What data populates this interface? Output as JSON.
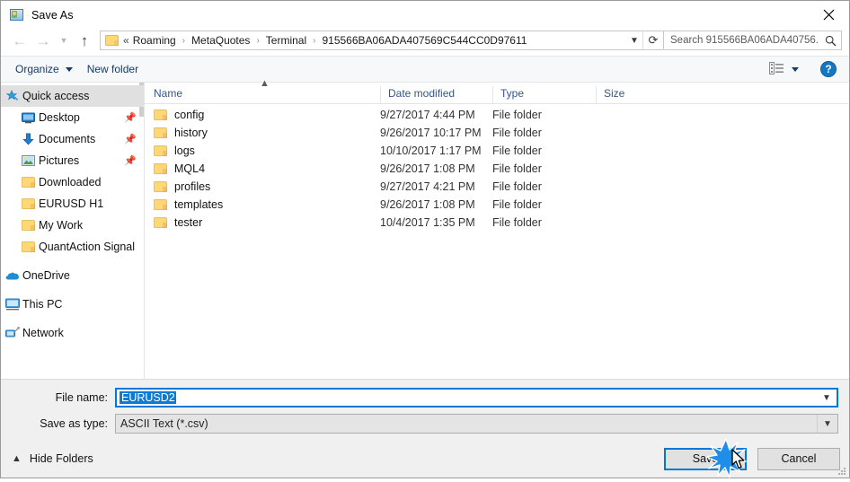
{
  "window": {
    "title": "Save As",
    "title_icon": "mt4-image-icon",
    "close_label": "close-icon"
  },
  "nav": {
    "back_icon": "arrow-left-icon",
    "forward_icon": "arrow-right-icon",
    "recent_icon": "chevron-down-icon",
    "up_icon": "arrow-up-icon",
    "breadcrumb": {
      "folder_icon": "folder-icon",
      "prefix": "«",
      "items": [
        "Roaming",
        "MetaQuotes",
        "Terminal",
        "915566BA06ADA407569C544CC0D97611"
      ],
      "separator": "›",
      "dropdown_icon": "chevron-down-icon",
      "refresh_icon": "refresh-icon"
    },
    "search": {
      "placeholder": "Search 915566BA06ADA40756...",
      "icon": "search-icon"
    }
  },
  "toolbar": {
    "organize_label": "Organize",
    "organize_caret": "caret-down-icon",
    "new_folder_label": "New folder",
    "view_icon": "details-view-icon",
    "view_caret": "caret-down-icon",
    "help_label": "?",
    "help_icon": "help-icon"
  },
  "sidebar": {
    "items": [
      {
        "label": "Quick access",
        "icon": "star-pin-icon",
        "level": "root",
        "selected": true,
        "pinned": false
      },
      {
        "label": "Desktop",
        "icon": "desktop-icon",
        "level": "child",
        "selected": false,
        "pinned": true
      },
      {
        "label": "Documents",
        "icon": "documents-arrow-icon",
        "level": "child",
        "selected": false,
        "pinned": true
      },
      {
        "label": "Pictures",
        "icon": "pictures-icon",
        "level": "child",
        "selected": false,
        "pinned": true
      },
      {
        "label": "Downloaded",
        "icon": "folder-icon",
        "level": "child",
        "selected": false,
        "pinned": false
      },
      {
        "label": "EURUSD H1",
        "icon": "folder-icon",
        "level": "child",
        "selected": false,
        "pinned": false
      },
      {
        "label": "My Work",
        "icon": "folder-icon",
        "level": "child",
        "selected": false,
        "pinned": false
      },
      {
        "label": "QuantAction Signal",
        "icon": "folder-icon",
        "level": "child",
        "selected": false,
        "pinned": false
      },
      {
        "label": "OneDrive",
        "icon": "onedrive-cloud-icon",
        "level": "root",
        "selected": false,
        "pinned": false,
        "gap_before": true
      },
      {
        "label": "This PC",
        "icon": "this-pc-icon",
        "level": "root",
        "selected": false,
        "pinned": false,
        "gap_before": true
      },
      {
        "label": "Network",
        "icon": "network-icon",
        "level": "root",
        "selected": false,
        "pinned": false,
        "gap_before": true
      }
    ]
  },
  "filelist": {
    "columns": [
      "Name",
      "Date modified",
      "Type",
      "Size"
    ],
    "sort_indicator": "sort-ascending-caret",
    "rows": [
      {
        "name": "config",
        "date": "9/27/2017 4:44 PM",
        "type": "File folder",
        "size": ""
      },
      {
        "name": "history",
        "date": "9/26/2017 10:17 PM",
        "type": "File folder",
        "size": ""
      },
      {
        "name": "logs",
        "date": "10/10/2017 1:17 PM",
        "type": "File folder",
        "size": ""
      },
      {
        "name": "MQL4",
        "date": "9/26/2017 1:08 PM",
        "type": "File folder",
        "size": ""
      },
      {
        "name": "profiles",
        "date": "9/27/2017 4:21 PM",
        "type": "File folder",
        "size": ""
      },
      {
        "name": "templates",
        "date": "9/26/2017 1:08 PM",
        "type": "File folder",
        "size": ""
      },
      {
        "name": "tester",
        "date": "10/4/2017 1:35 PM",
        "type": "File folder",
        "size": ""
      }
    ]
  },
  "form": {
    "filename_label": "File name:",
    "filename_value": "EURUSD2",
    "filename_selected": true,
    "filetype_label": "Save as type:",
    "filetype_value": "ASCII Text (*.csv)",
    "dropdown_icon": "chevron-down-icon"
  },
  "footer": {
    "hide_folders_label": "Hide Folders",
    "hide_folders_caret": "caret-up-icon",
    "save_label": "Save",
    "cancel_label": "Cancel",
    "resize_grip": "resize-grip-icon",
    "click_effect": "click-burst-effect",
    "cursor": "mouse-pointer-cursor"
  },
  "colors": {
    "accent": "#0078d7",
    "selection": "#0a7bd7",
    "header_text": "#34568b",
    "command_text": "#15396b",
    "folder_yellow": "#ffd775"
  }
}
